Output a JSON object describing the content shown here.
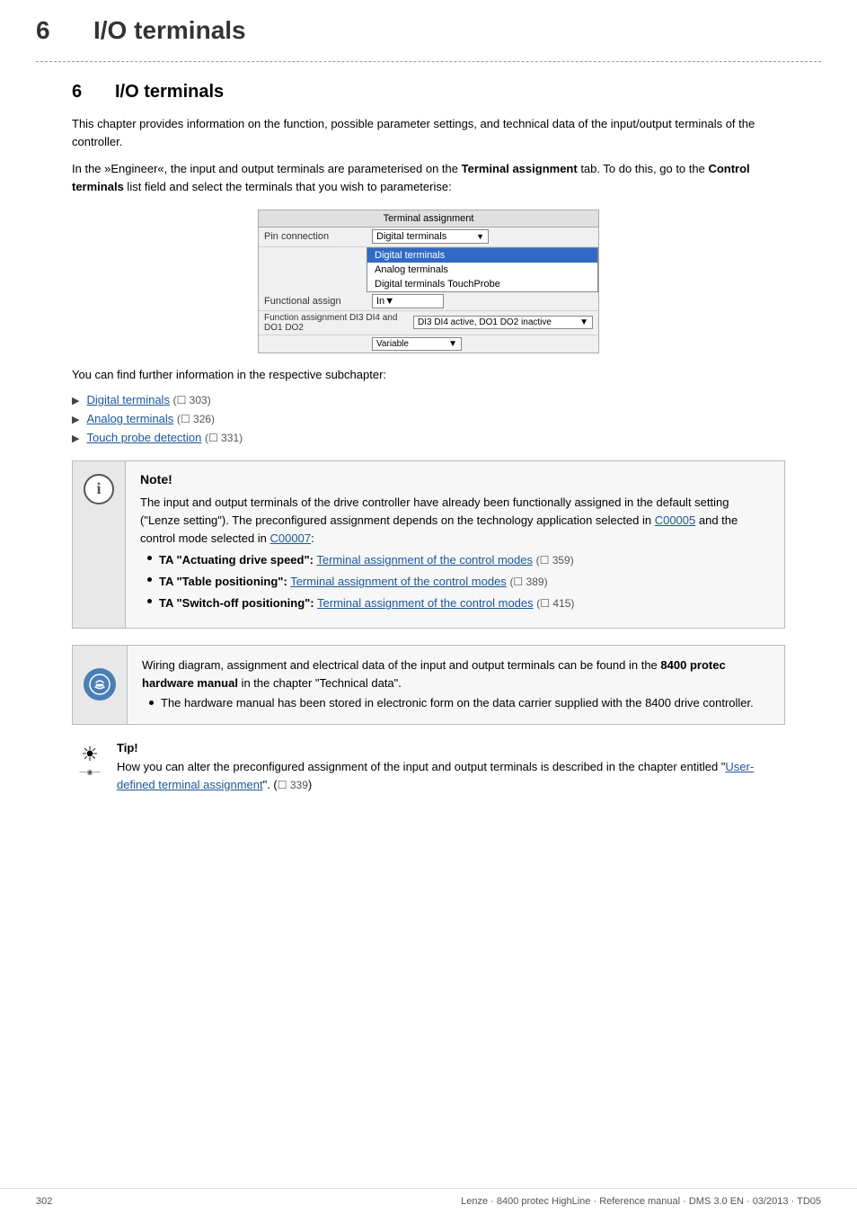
{
  "header": {
    "chapter_num": "6",
    "chapter_title": "I/O terminals"
  },
  "section": {
    "num": "6",
    "title": "I/O terminals"
  },
  "body": {
    "intro1": "This chapter provides information on the function, possible parameter settings, and technical data of the input/output terminals of the controller.",
    "intro2_before_bold": "In the »Engineer«, the input and output terminals are parameterised on the ",
    "intro2_bold1": "Terminal assignment",
    "intro2_mid": " tab. To do this, go to the ",
    "intro2_bold2": "Control terminals",
    "intro2_after": " list field and select the terminals that you wish to parameterise:",
    "further_info": "You can find further information in the respective subchapter:"
  },
  "screenshot": {
    "title": "Terminal assignment",
    "pin_label": "Pin connection",
    "pin_value": "Digital terminals",
    "menu_items": [
      {
        "label": "Digital terminals",
        "selected": true
      },
      {
        "label": "Analog terminals",
        "selected": false
      },
      {
        "label": "Digital terminals TouchProbe",
        "selected": false
      }
    ],
    "functional_label": "Functional assign",
    "functional_field": "In",
    "function_label": "Function assignment DI3 DI4 and DO1 DO2",
    "function_value": "DI3 DI4 active, DO1 DO2 inactive",
    "variable_label": "Variable"
  },
  "subchapters": [
    {
      "text": "Digital terminals",
      "page": "303"
    },
    {
      "text": "Analog terminals",
      "page": "326"
    },
    {
      "text": "Touch probe detection",
      "page": "331"
    }
  ],
  "note": {
    "title": "Note!",
    "body_intro": "The input and output terminals of the drive controller have already been functionally assigned in the default setting (\"Lenze setting\"). The preconfigured assignment depends on the technology application selected in ",
    "link1": "C00005",
    "body_mid": " and the control mode selected in ",
    "link2": "C00007",
    "body_after": ":",
    "bullets": [
      {
        "prefix_bold": "TA \"Actuating drive speed\":",
        "link": "Terminal assignment of the control modes",
        "page": "359"
      },
      {
        "prefix_bold": "TA \"Table positioning\":",
        "link": "Terminal assignment of the control modes",
        "page": "389"
      },
      {
        "prefix_bold": "TA \"Switch-off positioning\":",
        "link": "Terminal assignment of the control modes",
        "page": "415"
      }
    ]
  },
  "info_box": {
    "body1": "Wiring diagram, assignment and electrical data of the input and output terminals can be found in the ",
    "bold1": "8400 protec hardware manual",
    "body2": " in the chapter \"Technical data\".",
    "bullet": "The hardware manual has been stored in electronic form on the data carrier supplied with the 8400 drive controller."
  },
  "tip": {
    "label": "Tip!",
    "body_before": "How you can alter the preconfigured assignment of the input and output terminals is described in the chapter entitled \"",
    "link": "User-defined terminal assignment",
    "body_after": "\". (",
    "page_ref": "339",
    "body_end": ")"
  },
  "footer": {
    "page": "302",
    "manual": "Lenze · 8400 protec HighLine · Reference manual · DMS 3.0 EN · 03/2013 · TD05"
  }
}
